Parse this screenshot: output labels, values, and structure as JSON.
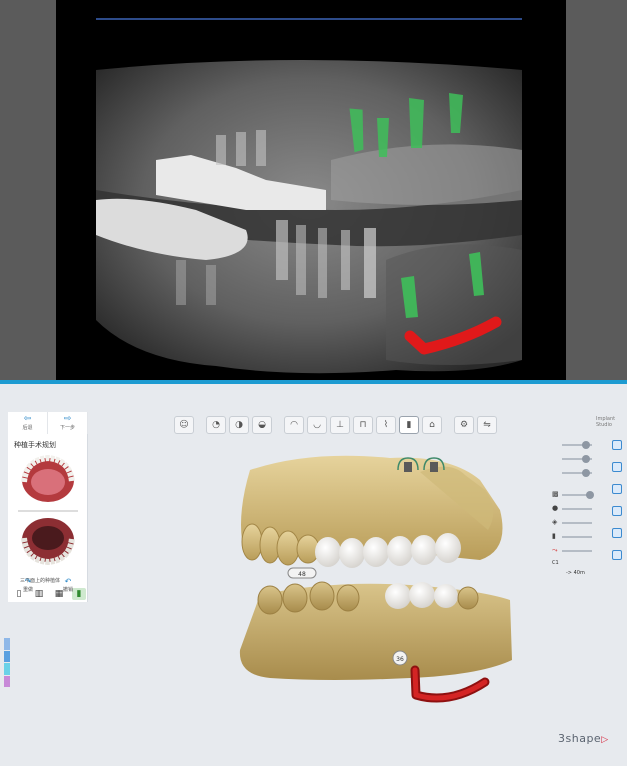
{
  "left_panel": {
    "nav_back": "后退",
    "nav_forward": "下一步",
    "title": "种植手术规划",
    "caption": "三平面上的种植体",
    "footer_left": "重做",
    "footer_right": "撤销"
  },
  "right_panel": {
    "brand_small_1": "Implant",
    "brand_small_2": "Studio",
    "label_c1": "C1",
    "value_c1": "-> 40m"
  },
  "scene": {
    "label_upper": "48",
    "label_lower": "36"
  },
  "logo": {
    "text": "3shape",
    "mark": "▷"
  },
  "colors": {
    "accent": "#1d9bd1",
    "implant_green": "#3fbf5a",
    "nerve_red": "#e0191a",
    "model": "#d9c48a",
    "tooth": "#efeeec"
  },
  "icons": {
    "toolbar": [
      "patient-icon",
      "model-icon",
      "scan-icon",
      "view-icon",
      "upper-jaw-icon",
      "lower-jaw-icon",
      "implant-icon",
      "sleeve-icon",
      "drill-icon",
      "implant-selected-icon",
      "guide-icon",
      "settings-icon",
      "compare-icon"
    ]
  }
}
